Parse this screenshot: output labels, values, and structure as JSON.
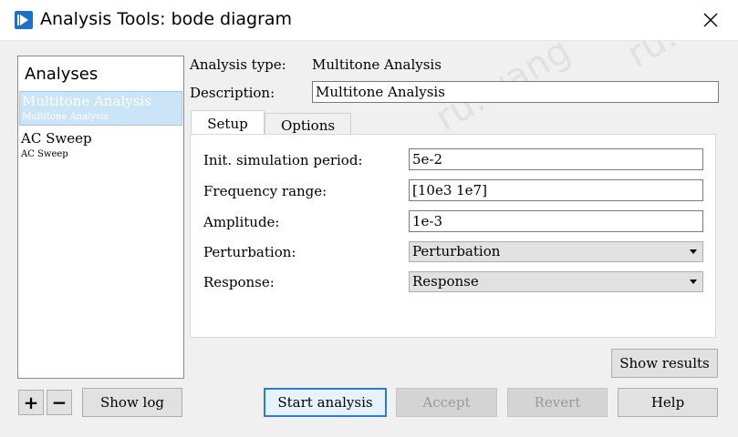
{
  "window": {
    "title": "Analysis Tools: bode diagram"
  },
  "analyses": {
    "header": "Analyses",
    "items": [
      {
        "name": "Multitone Analysis",
        "sub": "Multitone Analysis",
        "selected": true
      },
      {
        "name": "AC Sweep",
        "sub": "AC Sweep",
        "selected": false
      }
    ]
  },
  "analysis_type": {
    "label": "Analysis type:",
    "value": "Multitone Analysis"
  },
  "description": {
    "label": "Description:",
    "value": "Multitone Analysis"
  },
  "tabs": [
    {
      "label": "Setup",
      "active": true
    },
    {
      "label": "Options",
      "active": false
    }
  ],
  "setup": {
    "init_period": {
      "label": "Init. simulation period:",
      "value": "5e-2"
    },
    "freq_range": {
      "label": "Frequency range:",
      "value": "[10e3 1e7]"
    },
    "amplitude": {
      "label": "Amplitude:",
      "value": "1e-3"
    },
    "perturbation": {
      "label": "Perturbation:",
      "value": "Perturbation"
    },
    "response": {
      "label": "Response:",
      "value": "Response"
    }
  },
  "buttons": {
    "add": "+",
    "remove": "−",
    "show_log": "Show log",
    "show_results": "Show results",
    "start_analysis": "Start analysis",
    "accept": "Accept",
    "revert": "Revert",
    "help": "Help"
  },
  "watermark": "ru.wang"
}
